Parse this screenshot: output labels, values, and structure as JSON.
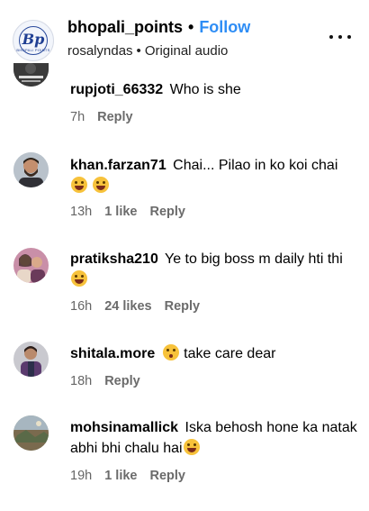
{
  "header": {
    "account": "bhopali_points",
    "follow_label": "Follow",
    "subtitle_user": "rosalyndas",
    "subtitle_audio": "Original audio",
    "logo_text": "Bp",
    "logo_subtext": "BHOPALI POINTS"
  },
  "comments": [
    {
      "username": "rupjoti_66332",
      "text": "Who is she",
      "time": "7h",
      "likes": "",
      "reply_label": "Reply"
    },
    {
      "username": "khan.farzan71",
      "text": "Chai... Pilao in ko koi chai",
      "time": "13h",
      "likes": "1 like",
      "reply_label": "Reply"
    },
    {
      "username": "pratiksha210",
      "text": "Ye to big boss m daily hti thi",
      "time": "16h",
      "likes": "24 likes",
      "reply_label": "Reply"
    },
    {
      "username": "shitala.more",
      "text": "take care dear",
      "time": "18h",
      "likes": "",
      "reply_label": "Reply"
    },
    {
      "username": "mohsinamallick",
      "text": "Iska behosh hone ka natak abhi bhi chalu hai",
      "time": "19h",
      "likes": "1 like",
      "reply_label": "Reply"
    }
  ],
  "icons": {
    "more": "more-horizontal-icon",
    "emoji_laugh": "tears-of-joy-emoji-icon",
    "emoji_flushed": "flushed-face-emoji-icon"
  }
}
